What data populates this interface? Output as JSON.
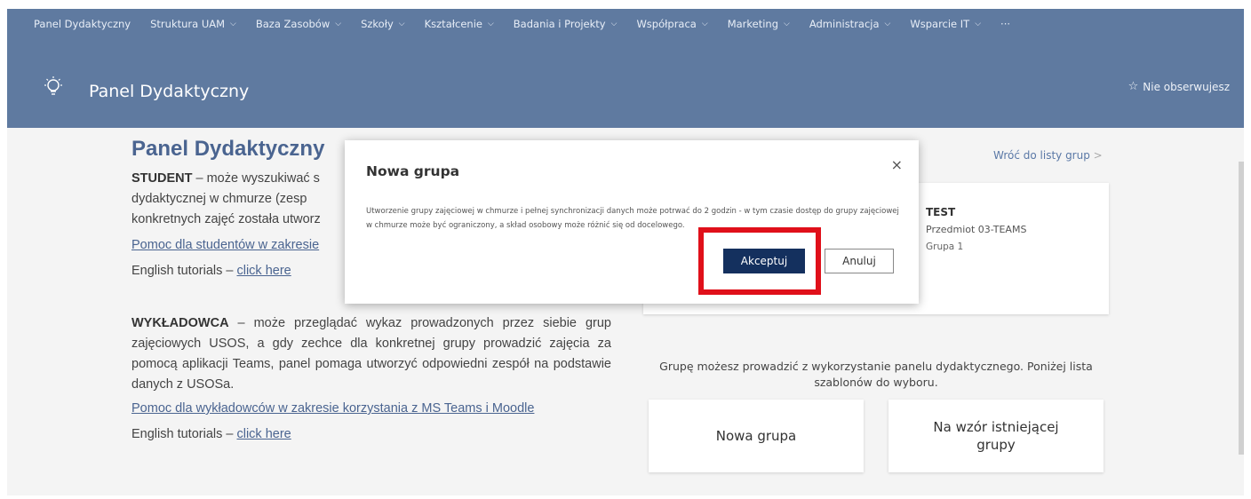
{
  "topnav": {
    "items": [
      {
        "label": "Panel Dydaktyczny",
        "dropdown": false
      },
      {
        "label": "Struktura UAM",
        "dropdown": true
      },
      {
        "label": "Baza Zasobów",
        "dropdown": true
      },
      {
        "label": "Szkoły",
        "dropdown": true
      },
      {
        "label": "Kształcenie",
        "dropdown": true
      },
      {
        "label": "Badania i Projekty",
        "dropdown": true
      },
      {
        "label": "Współpraca",
        "dropdown": true
      },
      {
        "label": "Marketing",
        "dropdown": true
      },
      {
        "label": "Administracja",
        "dropdown": true
      },
      {
        "label": "Wsparcie IT",
        "dropdown": true
      },
      {
        "label": "···",
        "dropdown": false
      }
    ],
    "chevron": "⌵"
  },
  "header": {
    "site_title": "Panel Dydaktyczny",
    "follow_label": "Nie obserwujesz",
    "follow_icon": "☆",
    "bg_color": "#5f7aa0"
  },
  "main": {
    "page_title": "Panel Dydaktyczny",
    "student": {
      "role": "STUDENT",
      "text": " – może wyszukiwać s",
      "line2": "dydaktycznej w chmurze (zesp",
      "line3": "konkretnych zajęć została utworz",
      "help_link": "Pomoc dla studentów w zakresie",
      "english_prefix": "English tutorials – ",
      "english_link": "click here"
    },
    "lecturer": {
      "role": "WYKŁADOWCA",
      "text": " – może przeglądać wykaz prowadzonych przez siebie grup zajęciowych USOS, a gdy zechce dla konkretnej grupy prowadzić zajęcia za pomocą aplikacji Teams, panel pomaga utworzyć odpowiedni zespół na podstawie danych z USOSa.",
      "help_link": "Pomoc dla wykładowców w zakresie korzystania z MS Teams i Moodle",
      "english_prefix": "English tutorials – ",
      "english_link": "click here"
    },
    "back_link": "Wróć do listy grup",
    "back_chevron": ">",
    "group": {
      "title": "TEST",
      "subject": "Przedmiot 03-TEAMS",
      "group": "Grupa 1"
    },
    "info_text": "Grupę możesz prowadzić z wykorzystanie panelu dydaktycznego. Poniżej lista szablonów do wyboru.",
    "tiles": [
      "Nowa grupa",
      "Na wzór istniejącej grupy"
    ]
  },
  "dialog": {
    "title": "Nowa grupa",
    "close": "×",
    "text": "Utworzenie grupy zajęciowej w chmurze i pełnej synchronizacji danych może potrwać do 2 godzin - w tym czasie dostęp do grupy zajęciowej w chmurze może być ograniczony, a skład osobowy może różnić się od docelowego.",
    "accept_label": "Akceptuj",
    "cancel_label": "Anuluj",
    "highlight_color": "#e0101a"
  }
}
